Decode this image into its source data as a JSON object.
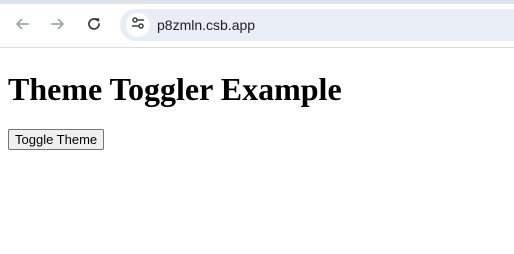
{
  "browser": {
    "url": "p8zmln.csb.app",
    "back_icon": "arrow-left-icon",
    "forward_icon": "arrow-right-icon",
    "reload_icon": "reload-icon",
    "site_info_icon": "tune-icon"
  },
  "page": {
    "title": "Theme Toggler Example",
    "toggle_button_label": "Toggle Theme"
  }
}
